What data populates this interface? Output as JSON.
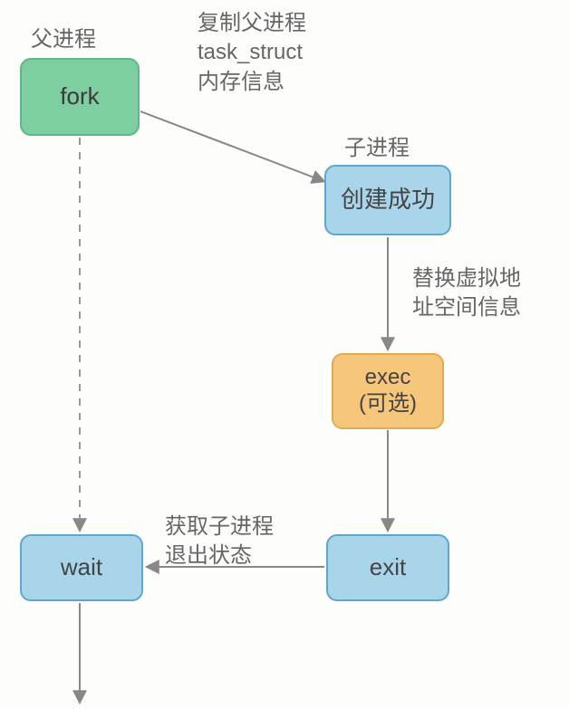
{
  "labels": {
    "parent_process": "父进程",
    "child_process": "子进程",
    "copy_parent_info": "复制父进程\ntask_struct\n内存信息",
    "replace_vmspace": "替换虚拟地\n址空间信息",
    "get_child_exit": "获取子进程\n退出状态"
  },
  "nodes": {
    "fork": "fork",
    "create_success": "创建成功",
    "exec_optional_l1": "exec",
    "exec_optional_l2": "(可选)",
    "exit": "exit",
    "wait": "wait"
  }
}
